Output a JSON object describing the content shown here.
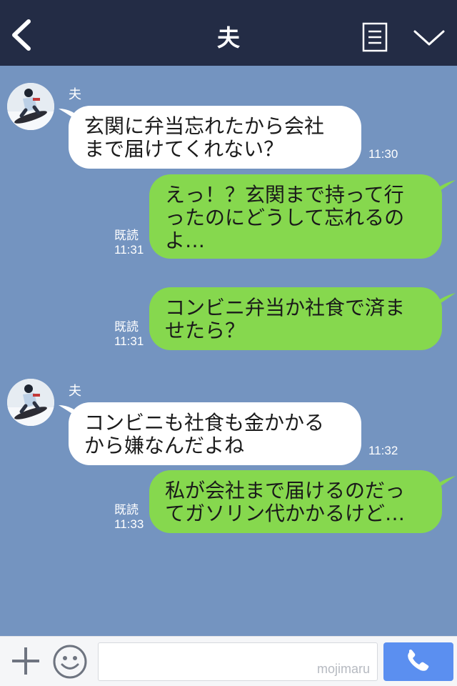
{
  "header": {
    "title": "夫",
    "back_icon": "chevron-left-icon",
    "notes_icon": "notes-icon",
    "menu_icon": "chevron-down-icon"
  },
  "messages": [
    {
      "sender": "夫",
      "lines": [
        "玄関に弁当忘れたから会社",
        "まで届けてくれない？"
      ],
      "time": "11:30"
    },
    {
      "lines": [
        "えっ！？玄関まで持って行",
        "ったのにどうして忘れるの",
        "よ…"
      ],
      "read": "既読",
      "time": "11:31"
    },
    {
      "lines": [
        "コンビニ弁当か社食で済ま",
        "せたら？"
      ],
      "read": "既読",
      "time": "11:31"
    },
    {
      "sender": "夫",
      "lines": [
        "コンビニも社食も金かかる",
        "から嫌なんだよね"
      ],
      "time": "11:32"
    },
    {
      "lines": [
        "私が会社まで届けるのだっ",
        "てガソリン代かかるけど…"
      ],
      "read": "既読",
      "time": "11:33"
    }
  ],
  "footer": {
    "watermark": "mojimaru",
    "plus_icon": "plus-icon",
    "emoji_icon": "smiley-icon",
    "call_icon": "phone-icon"
  },
  "colors": {
    "background": "#7494c0",
    "header": "#232c45",
    "outgoing_bubble": "#86d84e",
    "incoming_bubble": "#ffffff",
    "call_button": "#5b8ff0"
  }
}
